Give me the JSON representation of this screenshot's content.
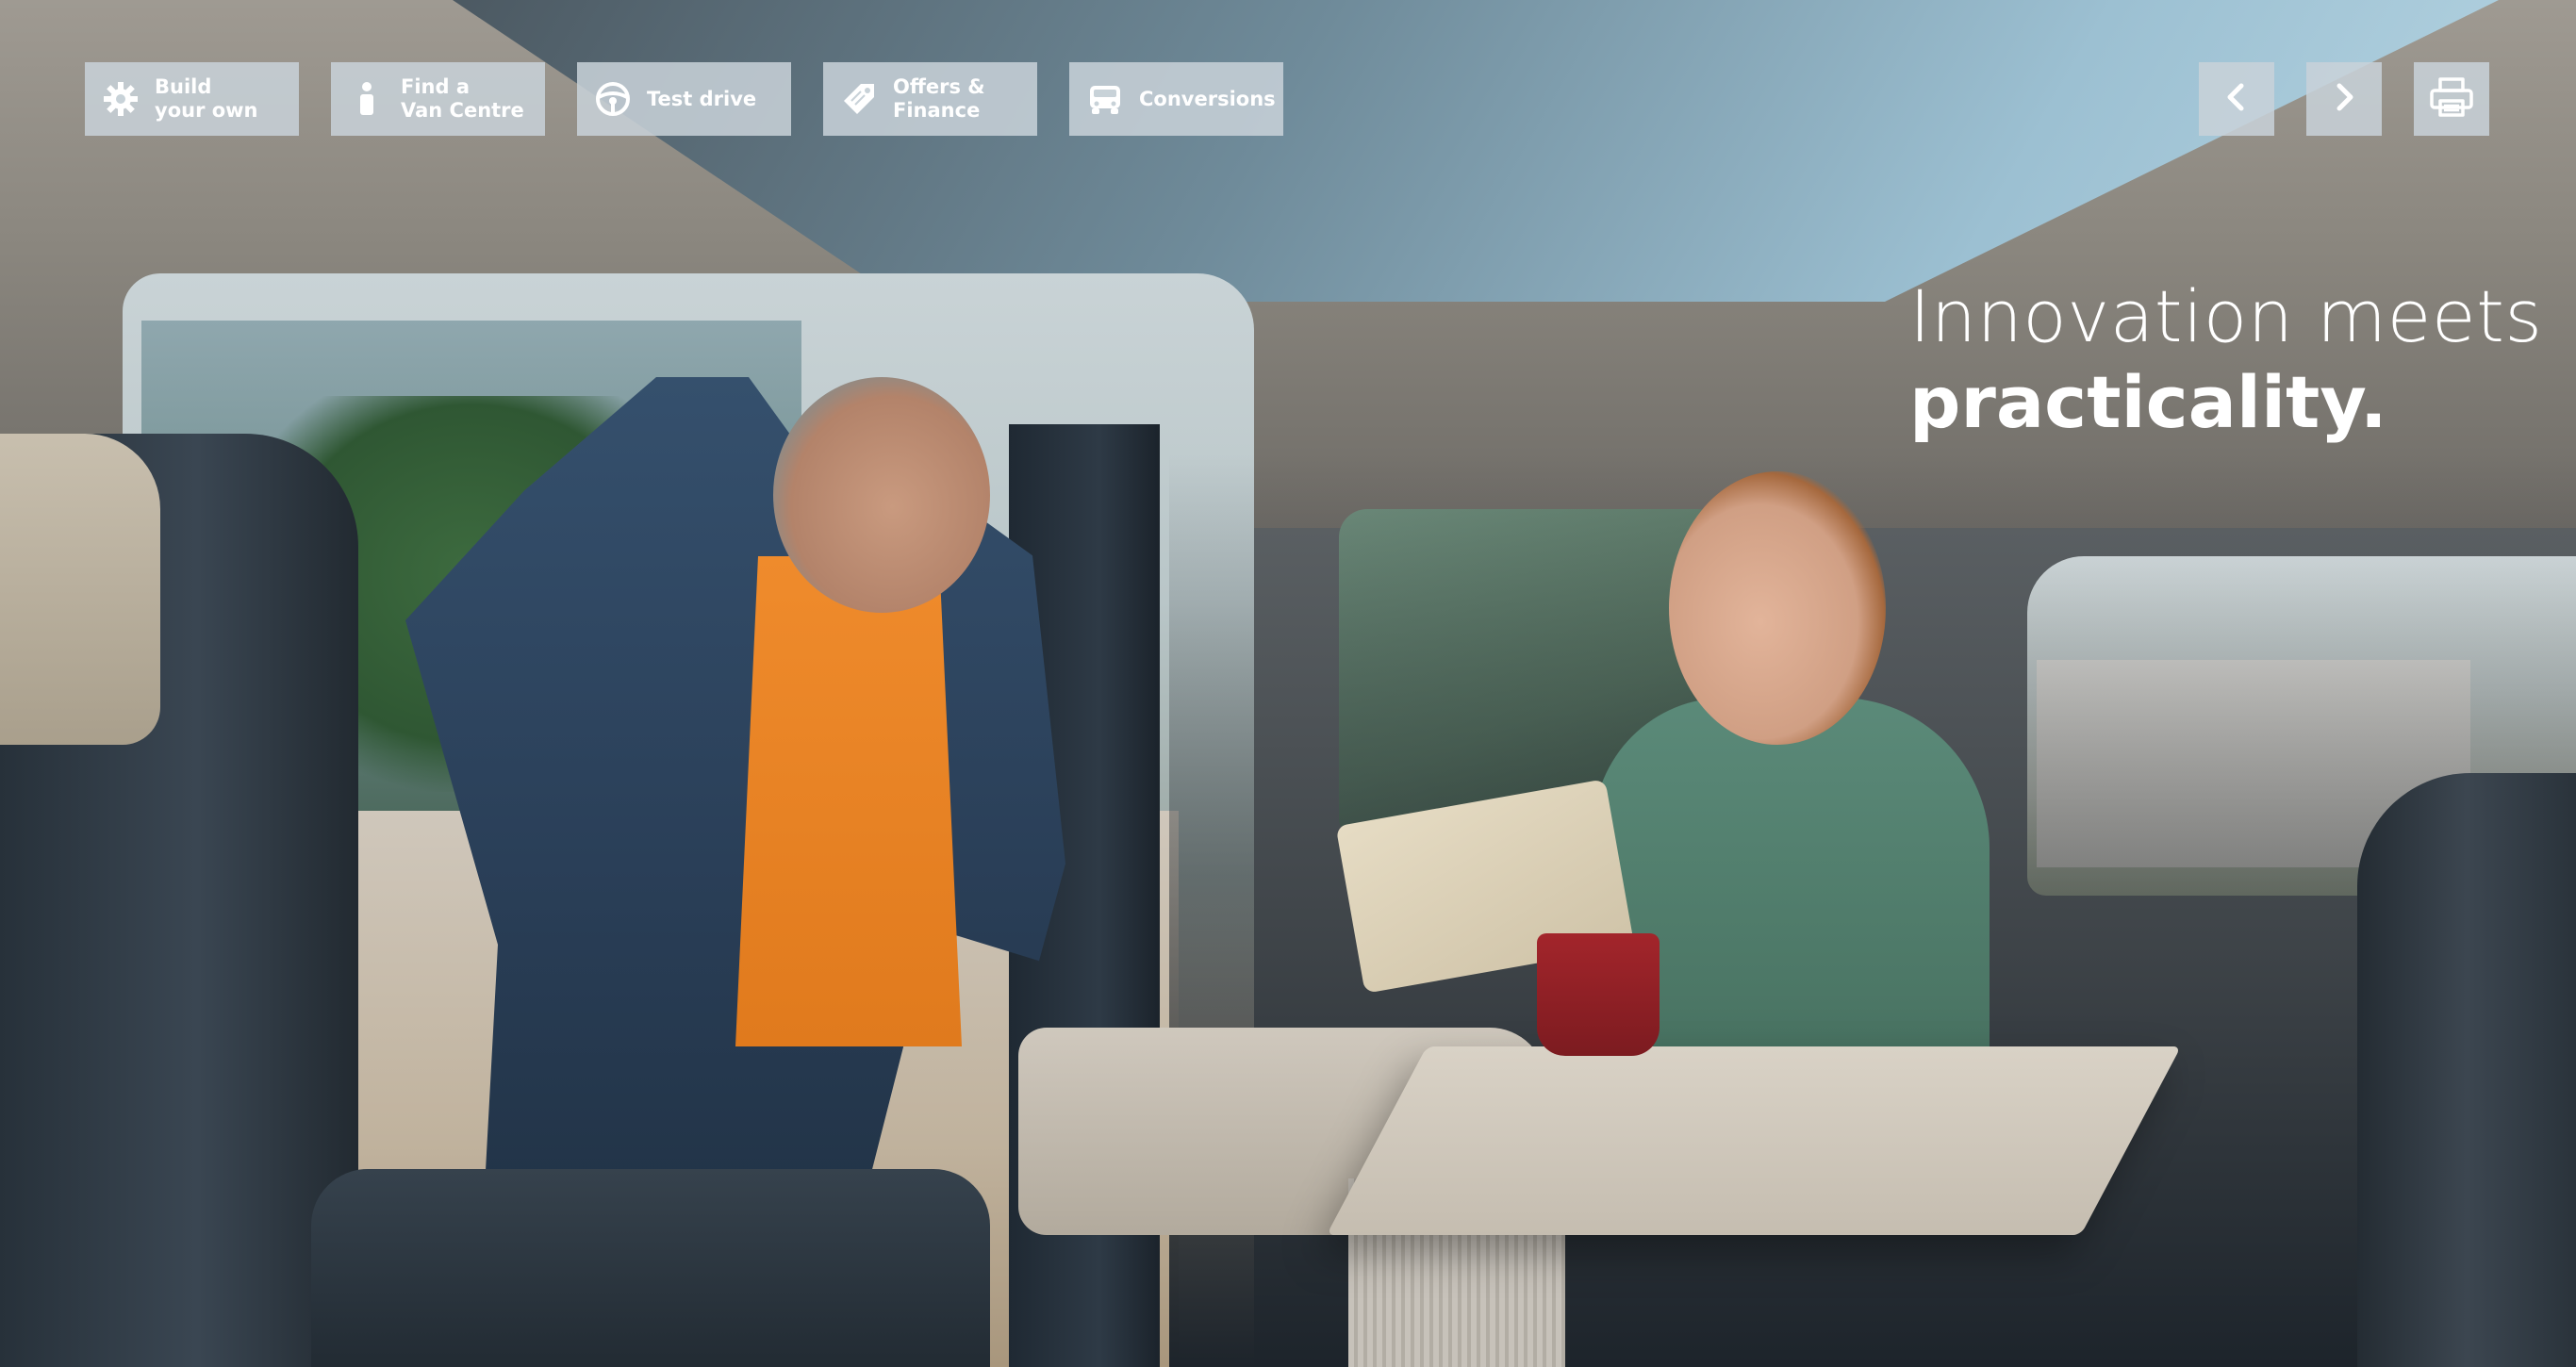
{
  "nav": {
    "items": [
      {
        "label": "Build\nyour own",
        "icon": "gear-icon"
      },
      {
        "label": "Find a\nVan Centre",
        "icon": "person-icon"
      },
      {
        "label": "Test drive",
        "icon": "steering-wheel-icon"
      },
      {
        "label": "Offers &\nFinance",
        "icon": "price-tag-icon"
      },
      {
        "label": "Conversions",
        "icon": "van-icon"
      }
    ]
  },
  "controls": {
    "prev_icon": "chevron-left-icon",
    "next_icon": "chevron-right-icon",
    "print_icon": "printer-icon"
  },
  "hero": {
    "headline_light": "Innovation meets",
    "headline_bold": "practicality.",
    "image_icon": "van-interior-photo"
  },
  "colors": {
    "button_bg": "#c8d2d8",
    "text": "#ffffff",
    "shirt": "#e07a1d"
  }
}
